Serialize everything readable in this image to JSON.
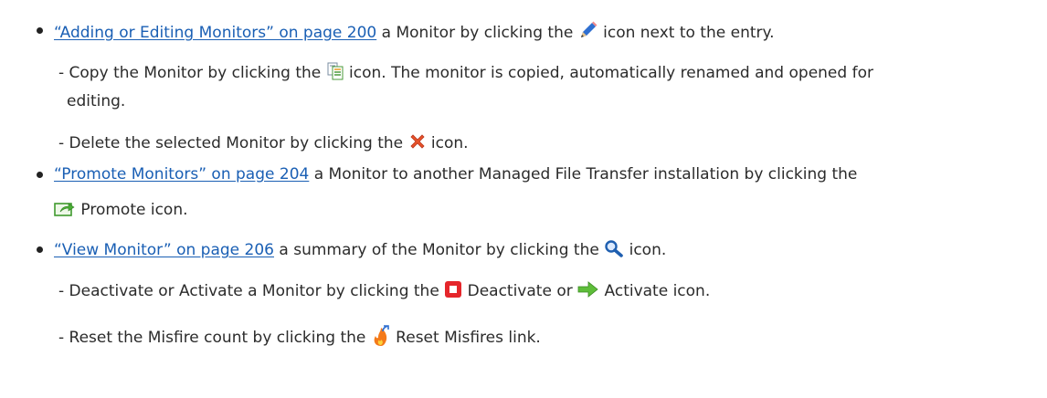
{
  "items": [
    {
      "link": "“Adding or Editing Monitors” on page 200",
      "text_before_icon": " a Monitor by clicking the ",
      "icon": "pencil-edit-icon",
      "text_after_icon": " icon next to the entry.",
      "subitems": [
        {
          "text_before_icon": "- Copy the Monitor by clicking the ",
          "icon": "copy-icon",
          "text_after_icon_line1": " icon. The monitor is copied, automatically renamed and opened for",
          "text_line2": "editing."
        },
        {
          "text_before_icon": "- Delete the selected Monitor by clicking the ",
          "icon": "delete-x-icon",
          "text_after_icon": " icon."
        }
      ]
    },
    {
      "link": "“Promote Monitors” on page 204",
      "text_line1": " a Monitor to another Managed File Transfer installation by clicking the",
      "icon": "promote-icon",
      "text_line2": " Promote icon."
    },
    {
      "link": "“View Monitor” on page 206",
      "text_before_icon": " a summary of the Monitor by clicking the ",
      "icon": "magnifier-icon",
      "text_after_icon": " icon.",
      "subitems": [
        {
          "text_before_icon": "- Deactivate or Activate a Monitor by clicking the ",
          "icon1": "deactivate-stop-icon",
          "text_middle": " Deactivate or ",
          "icon2": "activate-arrow-icon",
          "text_after": " Activate icon."
        },
        {
          "text_before_icon": "- Reset the Misfire count by clicking the ",
          "icon": "reset-misfire-icon",
          "text_after": " Reset Misfires link."
        }
      ]
    }
  ]
}
